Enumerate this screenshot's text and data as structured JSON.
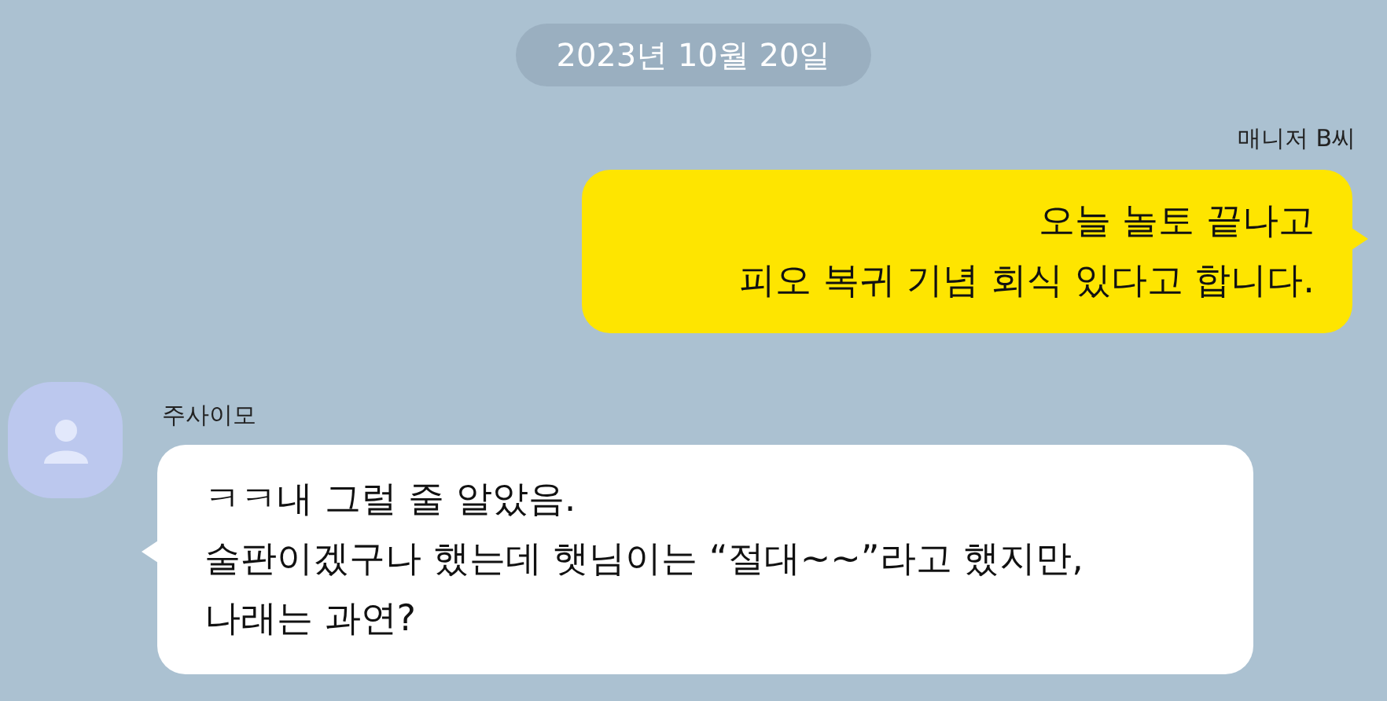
{
  "date_divider": "2023년 10월 20일",
  "messages": [
    {
      "kind": "sent",
      "sender": "매니저 B씨",
      "text": "오늘 놀토 끝나고\n피오 복귀 기념 회식 있다고 합니다."
    },
    {
      "kind": "received",
      "sender": "주사이모",
      "text": "ㅋㅋ내 그럴 줄 알았음.\n술판이겠구나 했는데 햇님이는 “절대~~”라고 했지만,\n나래는 과연?"
    }
  ]
}
